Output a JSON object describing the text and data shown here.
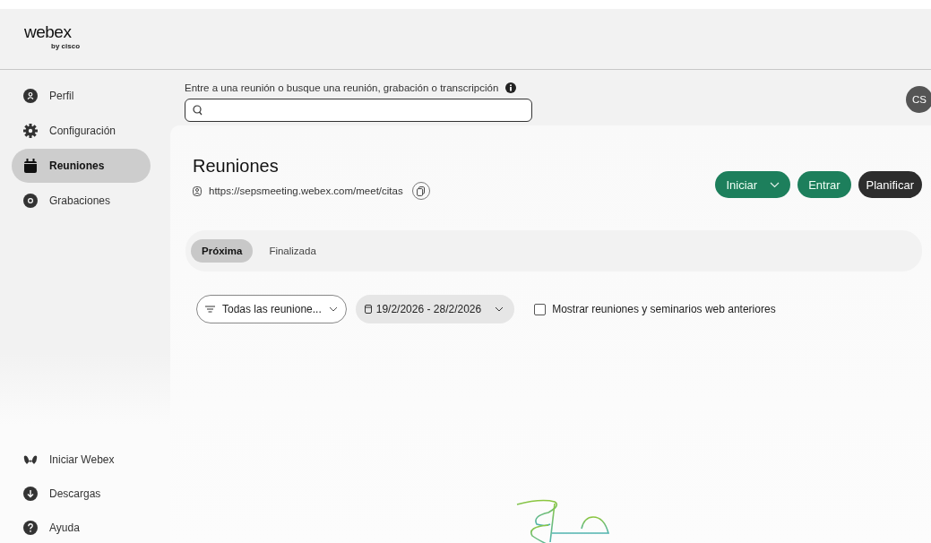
{
  "logo": {
    "name": "webex",
    "byline": "by cisco"
  },
  "sidebar": {
    "items": [
      {
        "label": "Perfil",
        "kind": "person",
        "selected": false
      },
      {
        "label": "Configuración",
        "kind": "gear",
        "selected": false
      },
      {
        "label": "Reuniones",
        "kind": "calendar",
        "selected": true
      },
      {
        "label": "Grabaciones",
        "kind": "record",
        "selected": false
      }
    ],
    "footer": [
      {
        "label": "Iniciar Webex",
        "kind": "webex"
      },
      {
        "label": "Descargas",
        "kind": "download"
      },
      {
        "label": "Ayuda",
        "kind": "help"
      }
    ]
  },
  "search": {
    "label": "Entre a una reunión o busque una reunión, grabación o transcripción"
  },
  "avatar": {
    "initials": "CS"
  },
  "page": {
    "title": "Reuniones",
    "url": "https://sepsmeeting.webex.com/meet/citas"
  },
  "actions": [
    {
      "label": "Iniciar",
      "kind": "split"
    },
    {
      "label": "Entrar",
      "kind": "primary"
    },
    {
      "label": "Planificar",
      "kind": "dark"
    }
  ],
  "tabs": [
    {
      "label": "Próxima",
      "selected": true
    },
    {
      "label": "Finalizada",
      "selected": false
    }
  ],
  "filters": {
    "meeting_type": "Todas las reunione...",
    "date_range": "19/2/2026 - 28/2/2026",
    "show_past": {
      "label": "Mostrar reuniones y seminarios web anteriores",
      "checked": false
    }
  }
}
